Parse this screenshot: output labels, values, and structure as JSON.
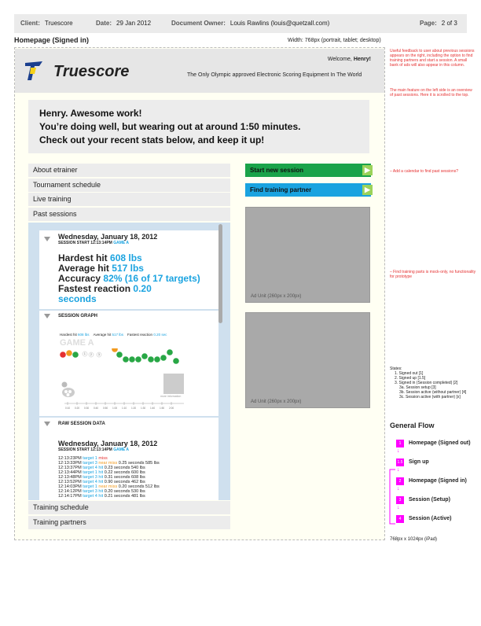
{
  "header": {
    "client_label": "Client:",
    "client": "Truescore",
    "date_label": "Date:",
    "date": "29 Jan 2012",
    "owner_label": "Document Owner:",
    "owner": "Louis Rawlins (louis@quetzall.com)",
    "page_label": "Page:",
    "page": "2 of 3"
  },
  "page_title": "Homepage (Signed in)",
  "width_note": "Width: 768px (portrait, tablet; desktop)",
  "screen_tag": "2",
  "brand": {
    "name": "Truescore",
    "welcome_prefix": "Welcome,",
    "welcome_name": "Henry!",
    "tagline": "The Only Olympic approved Electronic Scoring Equipment In The World"
  },
  "banner": {
    "line1": "Henry. Awesome work!",
    "line2": "You’re doing well, but wearing out at around 1:50 minutes.",
    "line3": "Check out your recent stats below, and keep it up!"
  },
  "nav": {
    "about": "About etrainer",
    "tournament": "Tournament schedule",
    "live": "Live training",
    "past": "Past sessions",
    "schedule": "Training schedule",
    "partners": "Training partners"
  },
  "actions": {
    "start": "Start new session",
    "find": "Find training partner"
  },
  "ads": {
    "label1": "Ad Unit (260px x 200px)",
    "label2": "Ad Unit (260px x 200px)"
  },
  "session": {
    "date": "Wednesday, January 18, 2012",
    "start_label": "SESSION START 12:13:14PM",
    "game": "GAME A",
    "hardest_label": "Hardest hit",
    "hardest": "608 lbs",
    "average_label": "Average hit",
    "average": "517 lbs",
    "accuracy_label": "Accuracy",
    "accuracy": "82% (16 of 17 targets)",
    "fastest_label": "Fastest reaction",
    "fastest_value": "0.20",
    "fastest_unit": "seconds",
    "graph_title": "SESSION GRAPH",
    "raw_title": "RAW SESSION DATA",
    "graph_hardest_label": "Hardest hit",
    "graph_hardest": "608 lbs",
    "graph_average_label": "Average hit",
    "graph_average": "517 lbs",
    "graph_fastest_label": "Fastest reaction",
    "graph_fastest": "0.20 sec",
    "graph_game": "GAME A",
    "graph_image_note": "more information"
  },
  "raw_rows": [
    {
      "time": "12:13:23PM",
      "target": "target 1",
      "result": "miss",
      "rest": ""
    },
    {
      "time": "12:13:33PM",
      "target": "target 3",
      "result": "near miss",
      "rest": "0.25 seconds 585 lbs"
    },
    {
      "time": "12:13:37PM",
      "target": "target 4",
      "result": "hit",
      "rest": "0.23 seconds 540 lbs"
    },
    {
      "time": "12:13:44PM",
      "target": "target 1",
      "result": "hit",
      "rest": "0.22 seconds 600 lbs"
    },
    {
      "time": "12:13:48PM",
      "target": "target 3",
      "result": "hit",
      "rest": "0.31 seconds 608 lbs"
    },
    {
      "time": "12:13:52PM",
      "target": "target 4",
      "result": "hit",
      "rest": "0.90 seconds 462 lbs"
    },
    {
      "time": "12:14:03PM",
      "target": "target 1",
      "result": "near miss",
      "rest": "0.20 seconds 512 lbs"
    },
    {
      "time": "12:14:12PM",
      "target": "target 3",
      "result": "hit",
      "rest": "0.20 seconds 530 lbs"
    },
    {
      "time": "12:14:17PM",
      "target": "target 4",
      "result": "hit",
      "rest": "0.21 seconds 481 lbs"
    }
  ],
  "graph_points": [
    {
      "color": "#e53030",
      "label": ""
    },
    {
      "color": "#f29a1e",
      "label": ""
    },
    {
      "color": "#28a745",
      "label": ""
    },
    {
      "color": "#ffffff",
      "label": "1"
    },
    {
      "color": "#ffffff",
      "label": "2"
    },
    {
      "color": "#ffffff",
      "label": "3"
    },
    {
      "color": "#f29a1e",
      "label": ""
    },
    {
      "color": "#28a745",
      "label": ""
    },
    {
      "color": "#28a745",
      "label": ""
    },
    {
      "color": "#28a745",
      "label": ""
    },
    {
      "color": "#28a745",
      "label": ""
    },
    {
      "color": "#28a745",
      "label": ""
    },
    {
      "color": "#28a745",
      "label": ""
    },
    {
      "color": "#28a745",
      "label": ""
    },
    {
      "color": "#28a745",
      "label": ""
    },
    {
      "color": "#28a745",
      "label": ""
    },
    {
      "color": "#28a745",
      "label": ""
    }
  ],
  "graph_ticks": [
    "0:10",
    "0:20",
    "0:30",
    "0:40",
    "0:50",
    "1:00",
    "1:10",
    "1:20",
    "1:30",
    "1:40",
    "1:50",
    "2:00"
  ],
  "notes": {
    "top": "Useful feedback to user about previous sessions appears on the right, including the option to find training partners and start a session. A small bank of ads will also appear in this column.",
    "top2": "The main feature on the left side is an overview of past sessions. Here it is scrolled to the top.",
    "calendar": "– Add a calendar to find past sessions?",
    "partners": "– Find training parts is mock-only, no functionality for prototype"
  },
  "states": {
    "title": "States:",
    "items": [
      "1. Signed out [1]",
      "2. Signed up [1.5]",
      "3. Signed in (Session completed) [2]",
      "3a. Session setup [3]",
      "3b. Session active (without partner) [4]",
      "3c. Session active (with partner) [x]"
    ]
  },
  "flow": {
    "title": "General Flow",
    "steps": [
      {
        "num": "1",
        "label": "Homepage (Signed out)"
      },
      {
        "num": "1.5",
        "label": "Sign up"
      },
      {
        "num": "2",
        "label": "Homepage (Signed in)"
      },
      {
        "num": "3",
        "label": "Session (Setup)"
      },
      {
        "num": "4",
        "label": "Session (Active)"
      }
    ]
  },
  "ipad_note": "768px x 1024px (iPad)",
  "colors": {
    "accent_green": "#1aa34a",
    "accent_blue": "#1aa3e0",
    "magenta": "#ff00ff"
  }
}
